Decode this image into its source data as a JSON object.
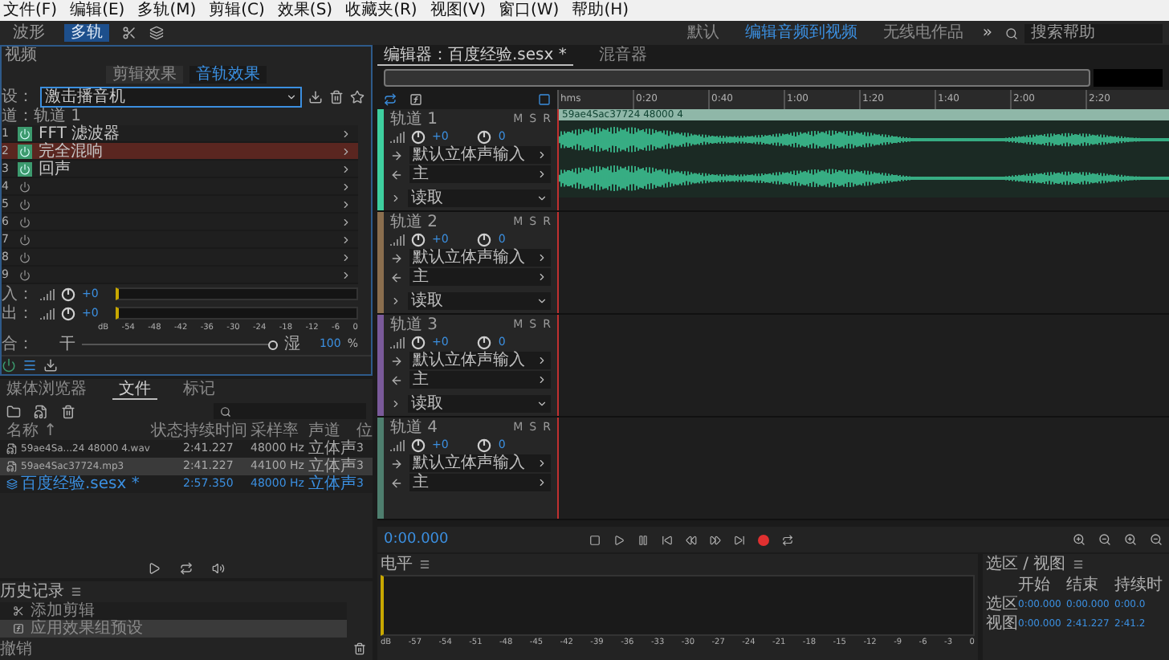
{
  "menu": [
    "文件(F)",
    "编辑(E)",
    "多轨(M)",
    "剪辑(C)",
    "效果(S)",
    "收藏夹(R)",
    "视图(V)",
    "窗口(W)",
    "帮助(H)"
  ],
  "toolbar": {
    "modes": [
      {
        "label": "波形",
        "selected": false
      },
      {
        "label": "多轨",
        "selected": true
      }
    ],
    "workspaces": [
      {
        "label": "默认",
        "selected": false
      },
      {
        "label": "编辑音频到视频",
        "selected": true
      },
      {
        "label": "无线电作品",
        "selected": false
      }
    ],
    "more": "»",
    "search": {
      "placeholder": "搜索帮助"
    }
  },
  "effects_panel": {
    "title": "视频",
    "tabs": [
      {
        "label": "剪辑效果",
        "selected": false
      },
      {
        "label": "音轨效果",
        "selected": true
      }
    ],
    "preset_label": "设：",
    "preset_value": "激击播音机",
    "track_label": "道：轨道 1",
    "rack": [
      {
        "number": "1",
        "name": "FFT 滤波器",
        "on": true,
        "selected": false
      },
      {
        "number": "2",
        "name": "完全混响",
        "on": true,
        "selected": true
      },
      {
        "number": "3",
        "name": "回声",
        "on": true,
        "selected": false
      },
      {
        "number": "4",
        "on": false,
        "selected": false
      },
      {
        "number": "5",
        "on": false,
        "selected": false
      },
      {
        "number": "6",
        "on": false,
        "selected": false
      },
      {
        "number": "7",
        "on": false,
        "selected": false
      },
      {
        "number": "8",
        "on": false,
        "selected": false
      },
      {
        "number": "9",
        "on": false,
        "selected": false
      }
    ],
    "input": {
      "label": "入：",
      "gain": "+0"
    },
    "output": {
      "label": "出：",
      "gain": "+0"
    },
    "meter_scale": [
      "dB",
      "-54",
      "-48",
      "-42",
      "-36",
      "-30",
      "-24",
      "-18",
      "-12",
      "-6",
      "0"
    ],
    "mix": {
      "label": "合：",
      "dry": "干",
      "wet": "湿",
      "level": 1,
      "value": "100",
      "unit": "%"
    }
  },
  "files_panel": {
    "tabs": [
      {
        "label": "媒体浏览器",
        "selected": false
      },
      {
        "label": "文件",
        "selected": true
      },
      {
        "label": "标记",
        "selected": false
      }
    ],
    "columns": [
      "名称 ↑",
      "状态",
      "持续时间",
      "采样率",
      "声道",
      "位"
    ],
    "rows": [
      {
        "kind": "audio",
        "name": "59ae4Sa...24 48000 4.wav",
        "duration": "2:41.227",
        "sample_rate": "48000 Hz",
        "channels": "立体声",
        "bits": "3",
        "selected": false
      },
      {
        "kind": "audio",
        "name": "59ae4Sac37724.mp3",
        "duration": "2:41.227",
        "sample_rate": "44100 Hz",
        "channels": "立体声",
        "bits": "3",
        "selected": true
      },
      {
        "kind": "session",
        "name": "百度经验.sesx *",
        "duration": "2:57.350",
        "sample_rate": "48000 Hz",
        "channels": "立体声",
        "bits": "3",
        "selected": false
      }
    ]
  },
  "history_panel": {
    "title": "历史记录",
    "items": [
      {
        "kind": "clip",
        "label": "添加剪辑",
        "selected": false
      },
      {
        "kind": "fx",
        "label": "应用效果组预设",
        "selected": true
      }
    ],
    "undo": "撤销"
  },
  "editor": {
    "tabs": [
      {
        "label": "编辑器：百度经验.sesx *",
        "selected": true
      },
      {
        "label": "混音器",
        "selected": false
      }
    ],
    "ruler": [
      "hms",
      "0:20",
      "0:40",
      "1:00",
      "1:20",
      "1:40",
      "2:00",
      "2:20"
    ],
    "tracks": [
      {
        "name": "轨道 1",
        "color": "#3ecf9f",
        "buttons": [
          "M",
          "S",
          "R"
        ],
        "volume": "+0",
        "pan": "0",
        "input": "默认立体声输入",
        "output": "主",
        "mode": "读取",
        "clip": "59ae4Sac37724 48000 4"
      },
      {
        "name": "轨道 2",
        "color": "#8a6e4e",
        "buttons": [
          "M",
          "S",
          "R"
        ],
        "volume": "+0",
        "pan": "0",
        "input": "默认立体声输入",
        "output": "主",
        "mode": "读取"
      },
      {
        "name": "轨道 3",
        "color": "#7a5a9a",
        "buttons": [
          "M",
          "S",
          "R"
        ],
        "volume": "+0",
        "pan": "0",
        "input": "默认立体声输入",
        "output": "主",
        "mode": "读取"
      },
      {
        "name": "轨道 4",
        "color": "#4e7e6e",
        "buttons": [
          "M",
          "S",
          "R"
        ],
        "volume": "+0",
        "pan": "0",
        "input": "默认立体声输入",
        "output": "主"
      }
    ],
    "time": "0:00.000"
  },
  "level_panel": {
    "title": "电平",
    "scale": [
      "dB",
      "-57",
      "-54",
      "-51",
      "-48",
      "-45",
      "-42",
      "-39",
      "-36",
      "-33",
      "-30",
      "-27",
      "-24",
      "-21",
      "-18",
      "-15",
      "-12",
      "-9",
      "-6",
      "-3",
      "0"
    ]
  },
  "selection_panel": {
    "title": "选区 / 视图",
    "columns": [
      "开始",
      "结束",
      "持续时"
    ],
    "rows": [
      {
        "label": "选区",
        "values": [
          "0:00.000",
          "0:00.000",
          "0:00.0"
        ]
      },
      {
        "label": "视图",
        "values": [
          "0:00.000",
          "2:41.227",
          "2:41.2"
        ]
      }
    ]
  }
}
